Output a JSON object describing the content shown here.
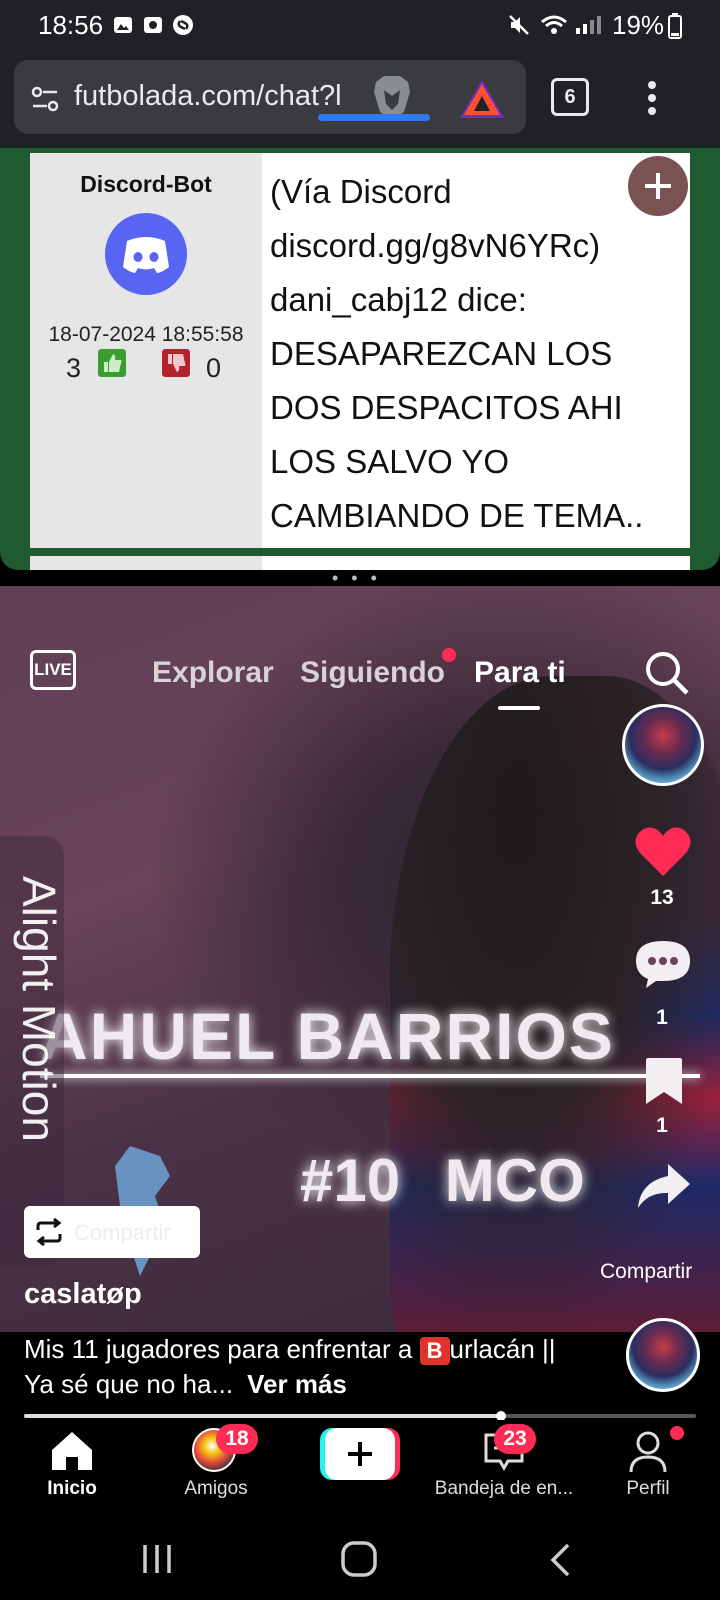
{
  "status_bar": {
    "time": "18:56",
    "battery": "19%"
  },
  "browser": {
    "url": "futbolada.com/chat?l",
    "tab_count": "6"
  },
  "chat_post": {
    "author": "Discord-Bot",
    "date": "18-07-2024 18:55:58",
    "likes": "3",
    "dislikes": "0",
    "message": "(Vía Discord discord.gg/g8vN6YRc) dani_cabj12 dice: DESAPAREZCAN LOS DOS DESPACITOS AHI LOS SALVO YO CAMBIANDO DE TEMA.."
  },
  "video": {
    "overlay_name": "AHUEL BARRIOS",
    "overlay_number": "#10 MCO",
    "watermark": "Alight Motion",
    "live_label": "LIVE",
    "tabs": [
      {
        "label": "Explorar",
        "active": false
      },
      {
        "label": "Siguiendo",
        "active": false
      },
      {
        "label": "Para ti",
        "active": true
      }
    ],
    "likes": "13",
    "comments": "1",
    "saves": "1",
    "share_label": "Compartir",
    "repost_label": "Compartir",
    "username": "caslatøp",
    "caption_emoji": "B",
    "caption": "Mis 11 jugadores para enfrentar a ",
    "caption_rest": "urlacán || Ya sé que no ha...",
    "see_more": "Ver más",
    "progress": 0.71,
    "like_color": "#fe2c55"
  },
  "tab_bar": {
    "items": [
      {
        "label": "Inicio",
        "icon": "home-icon"
      },
      {
        "label": "Amigos",
        "icon": "friends-avatar",
        "badge": "18"
      },
      {
        "label": "",
        "icon": "create-plus-icon"
      },
      {
        "label": "Bandeja de en...",
        "icon": "inbox-icon",
        "badge": "23"
      },
      {
        "label": "Perfil",
        "icon": "profile-icon"
      }
    ]
  }
}
